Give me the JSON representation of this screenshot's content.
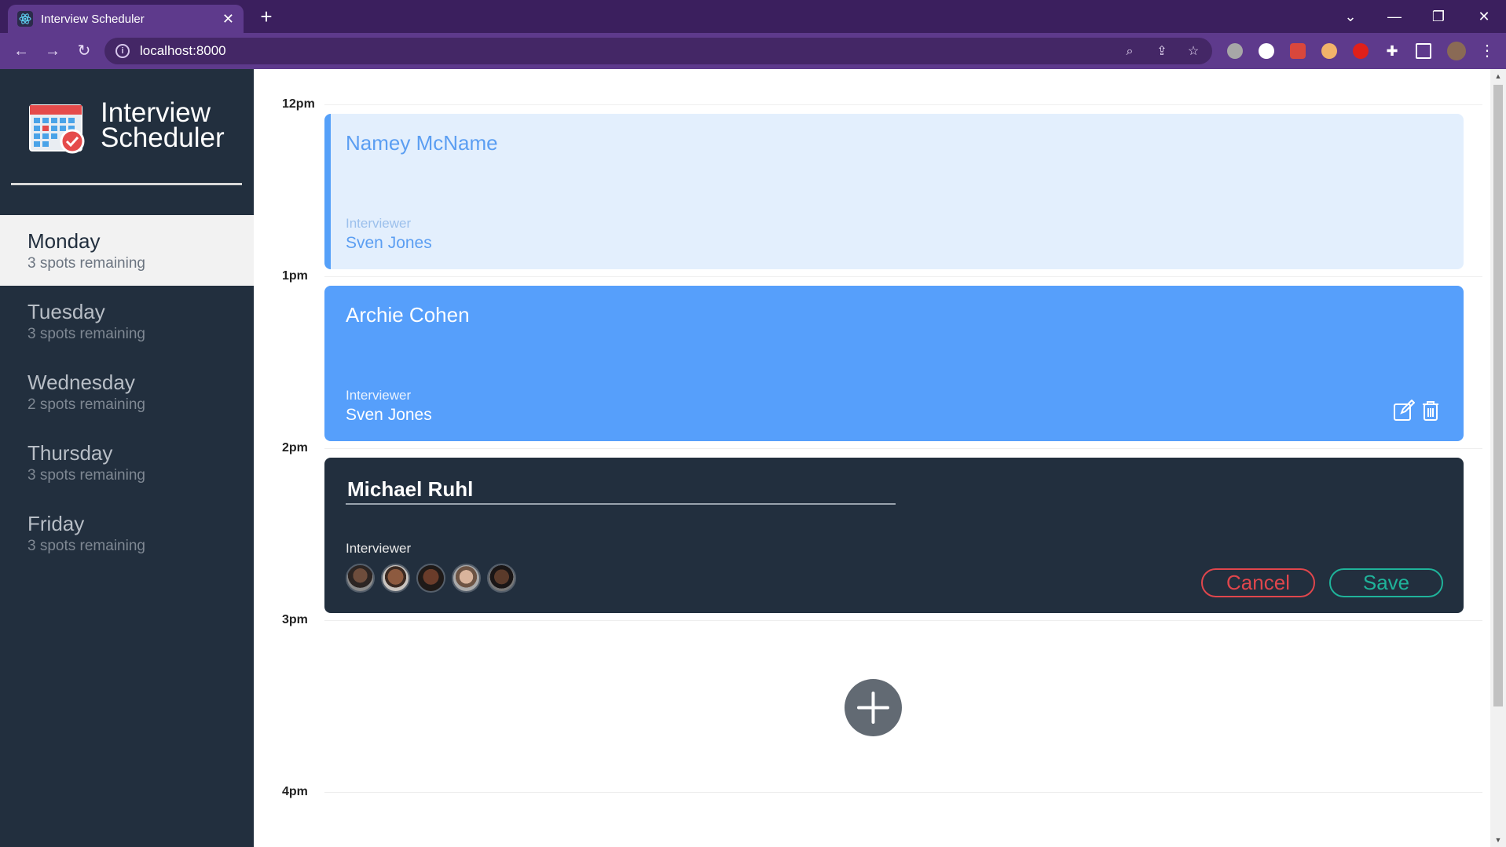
{
  "browser": {
    "tab_title": "Interview Scheduler",
    "tab_close": "✕",
    "new_tab": "+",
    "url": "localhost:8000"
  },
  "app": {
    "title_line1": "Interview",
    "title_line2": "Scheduler"
  },
  "days": [
    {
      "name": "Monday",
      "spots": "3 spots remaining",
      "selected": true
    },
    {
      "name": "Tuesday",
      "spots": "3 spots remaining",
      "selected": false
    },
    {
      "name": "Wednesday",
      "spots": "2 spots remaining",
      "selected": false
    },
    {
      "name": "Thursday",
      "spots": "3 spots remaining",
      "selected": false
    },
    {
      "name": "Friday",
      "spots": "3 spots remaining",
      "selected": false
    }
  ],
  "times": [
    "12pm",
    "1pm",
    "2pm",
    "3pm",
    "4pm"
  ],
  "appointments": [
    {
      "student": "Namey McName",
      "interviewer_label": "Interviewer",
      "interviewer": "Sven Jones"
    },
    {
      "student": "Archie Cohen",
      "interviewer_label": "Interviewer",
      "interviewer": "Sven Jones"
    }
  ],
  "form": {
    "student_name": "Michael Ruhl",
    "interviewer_label": "Interviewer",
    "cancel_label": "Cancel",
    "save_label": "Save"
  },
  "colors": {
    "sidebar": "#222f3e",
    "appt_selected_bg": "#e3effd",
    "appt_hover_bg": "#569ffb",
    "cancel": "#e0464c",
    "save": "#1fb39a"
  }
}
